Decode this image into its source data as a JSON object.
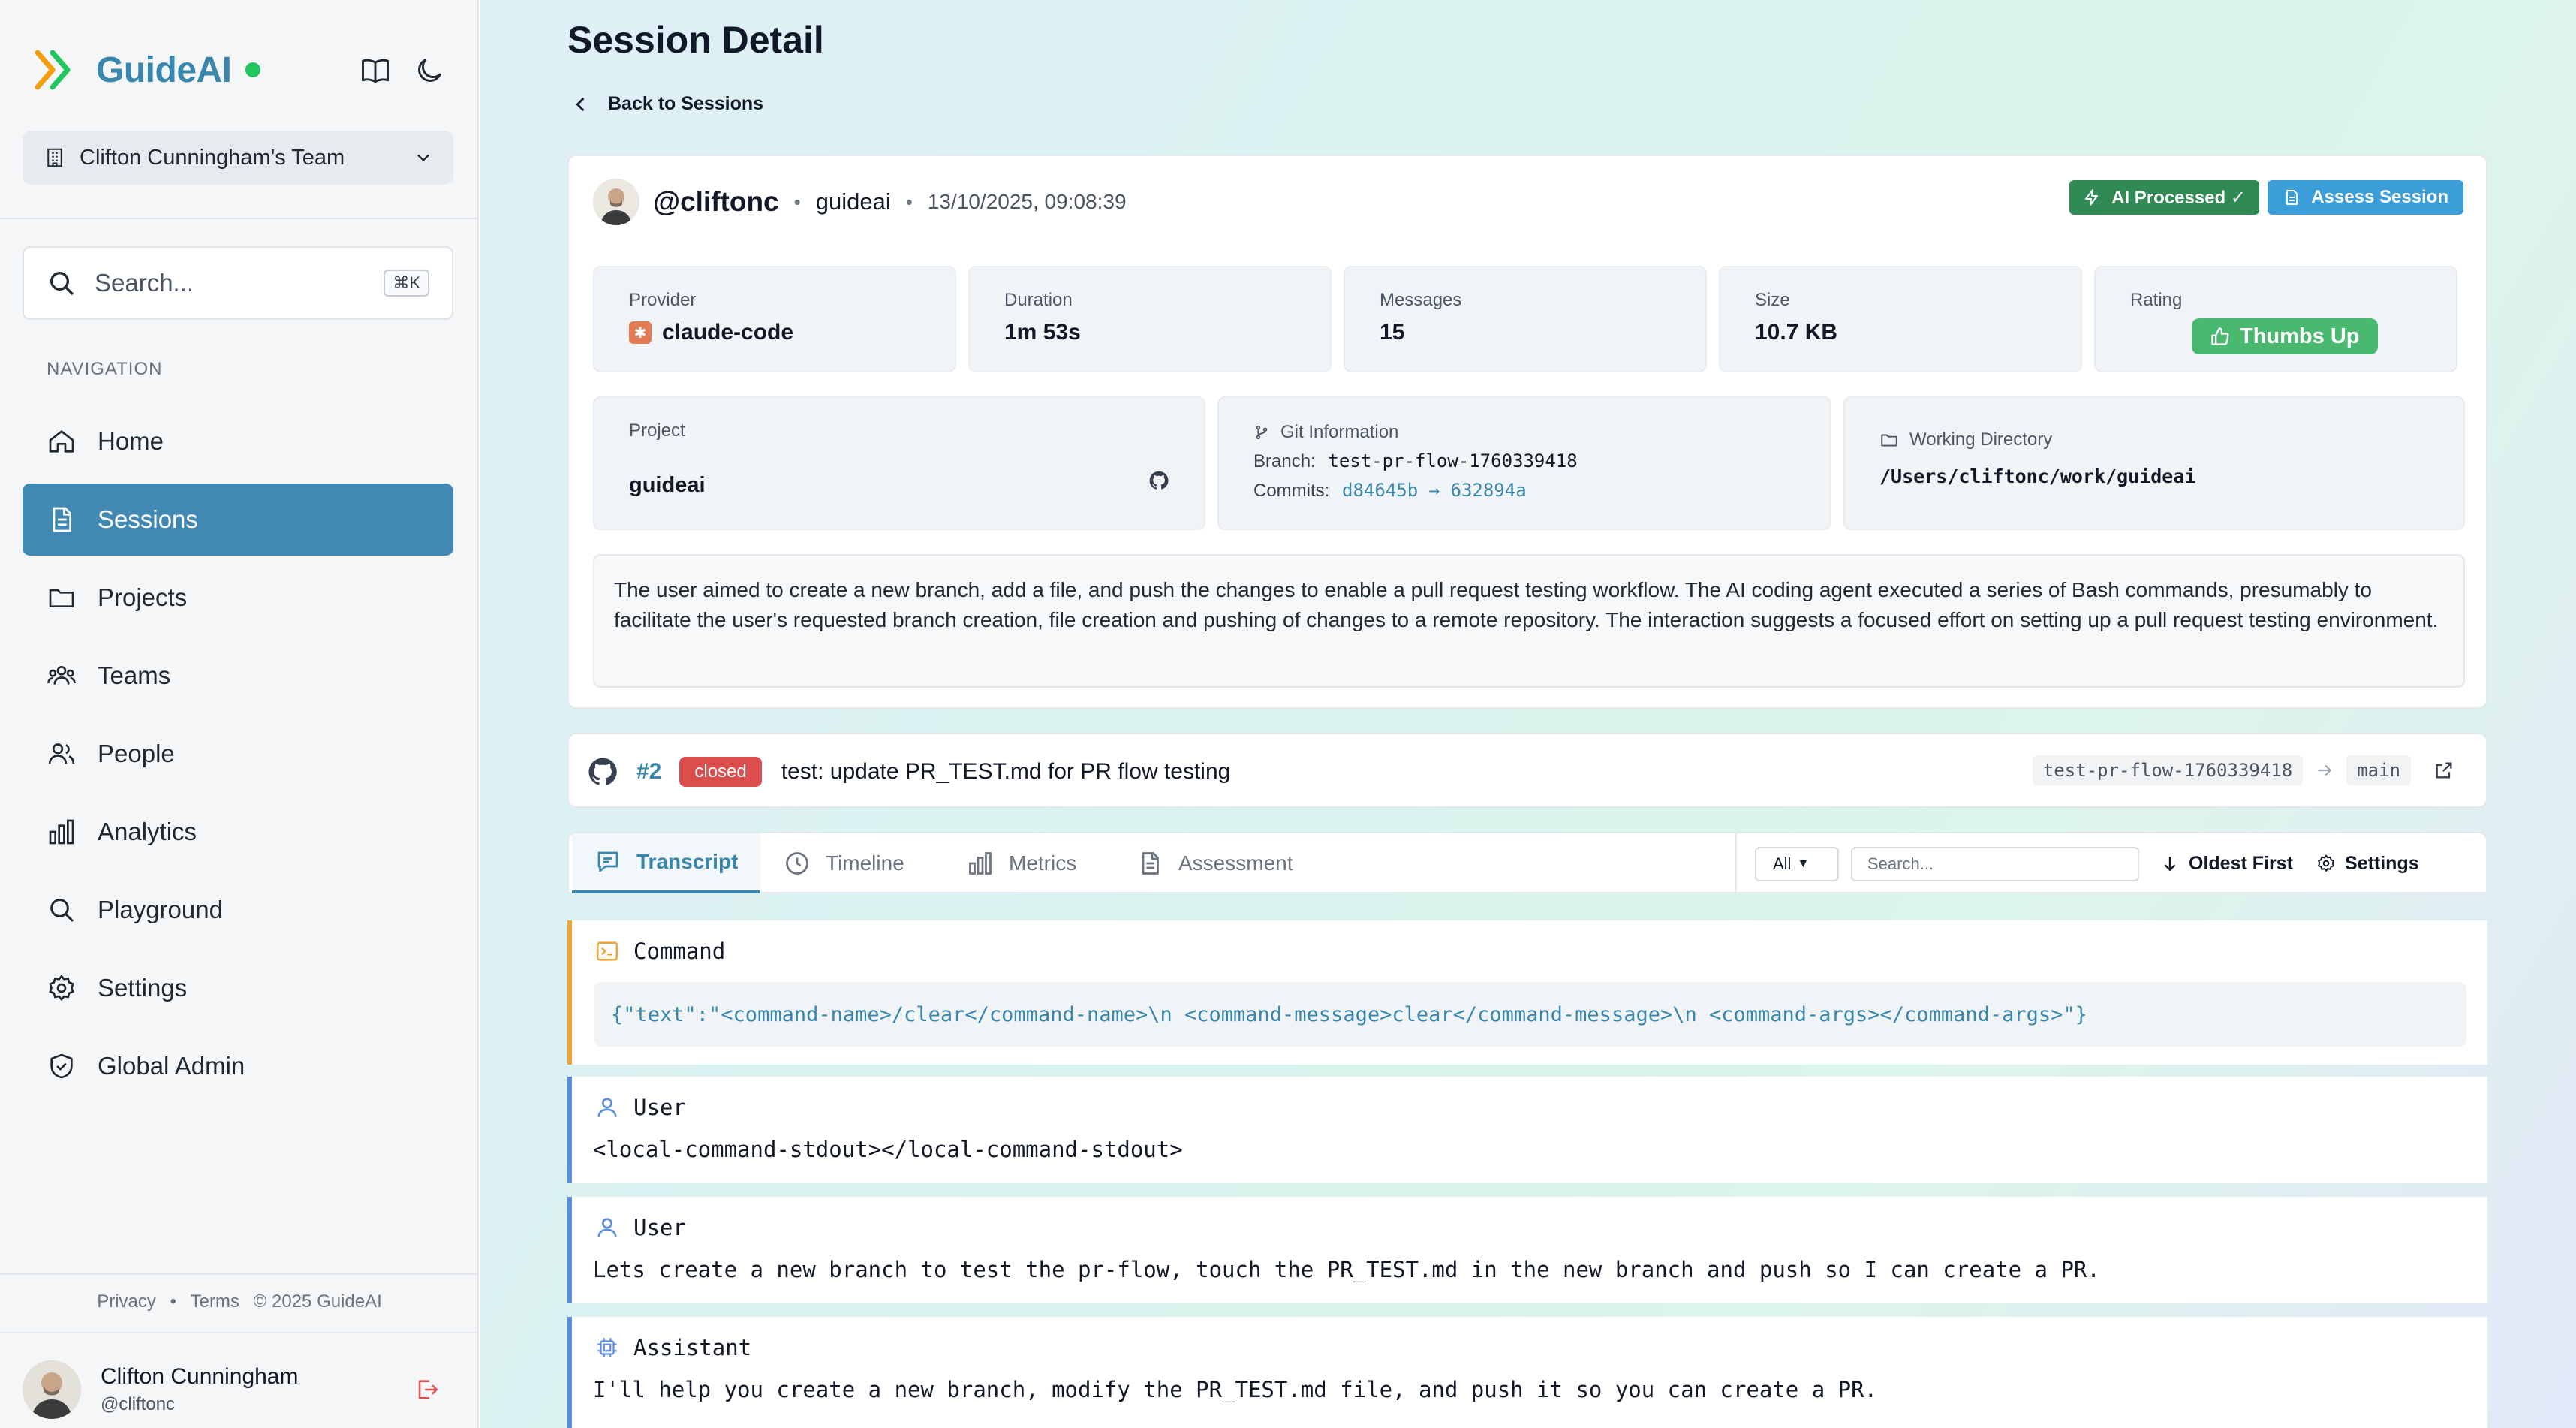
{
  "app": {
    "name": "GuideAI",
    "team": "Clifton Cunningham's Team",
    "search_placeholder": "Search...",
    "search_shortcut": "⌘K",
    "nav_heading": "NAVIGATION",
    "nav": [
      {
        "label": "Home",
        "icon": "home-icon"
      },
      {
        "label": "Sessions",
        "icon": "document-icon",
        "active": true
      },
      {
        "label": "Projects",
        "icon": "folder-icon"
      },
      {
        "label": "Teams",
        "icon": "team-icon"
      },
      {
        "label": "People",
        "icon": "people-icon"
      },
      {
        "label": "Analytics",
        "icon": "bar-chart-icon"
      },
      {
        "label": "Playground",
        "icon": "search-icon"
      },
      {
        "label": "Settings",
        "icon": "gear-icon"
      },
      {
        "label": "Global Admin",
        "icon": "shield-icon"
      }
    ],
    "footer": {
      "privacy": "Privacy",
      "sep": "•",
      "terms": "Terms",
      "copyright": "© 2025 GuideAI"
    },
    "user": {
      "name": "Clifton Cunningham",
      "handle": "@cliftonc"
    }
  },
  "page": {
    "title": "Session Detail",
    "back_label": "Back to Sessions"
  },
  "session": {
    "handle": "@cliftonc",
    "sep": "•",
    "project": "guideai",
    "datetime": "13/10/2025, 09:08:39",
    "ai_processed_label": "AI Processed ✓",
    "assess_label": "Assess Session",
    "stats": {
      "provider_label": "Provider",
      "provider_value": "claude-code",
      "duration_label": "Duration",
      "duration_value": "1m 53s",
      "messages_label": "Messages",
      "messages_value": "15",
      "size_label": "Size",
      "size_value": "10.7 KB",
      "rating_label": "Rating",
      "rating_value": "Thumbs Up"
    },
    "project_box": {
      "label": "Project",
      "name": "guideai"
    },
    "git": {
      "label": "Git Information",
      "branch_label": "Branch:",
      "branch": "test-pr-flow-1760339418",
      "commits_label": "Commits:",
      "commits": "d84645b → 632894a"
    },
    "working_dir": {
      "label": "Working Directory",
      "path": "/Users/cliftonc/work/guideai"
    },
    "summary": "The user aimed to create a new branch, add a file, and push the changes to enable a pull request testing workflow. The AI coding agent executed a series of Bash commands, presumably to facilitate the user's requested branch creation, file creation and pushing of changes to a remote repository. The interaction suggests a focused effort on setting up a pull request testing environment."
  },
  "pr": {
    "number": "#2",
    "state": "closed",
    "title": "test: update PR_TEST.md for PR flow testing",
    "head": "test-pr-flow-1760339418",
    "base": "main"
  },
  "tabs": [
    {
      "label": "Transcript",
      "icon": "chat-icon",
      "active": true
    },
    {
      "label": "Timeline",
      "icon": "clock-icon"
    },
    {
      "label": "Metrics",
      "icon": "bar-chart-icon"
    },
    {
      "label": "Assessment",
      "icon": "document-icon"
    }
  ],
  "toolbar": {
    "filter_value": "All",
    "search_placeholder": "Search...",
    "sort_label": "Oldest First",
    "settings_label": "Settings"
  },
  "messages": [
    {
      "role": "Command",
      "content": "{\"text\":\"<command-name>/clear</command-name>\\n <command-message>clear</command-message>\\n <command-args></command-args>\"}"
    },
    {
      "role": "User",
      "content": "<local-command-stdout></local-command-stdout>"
    },
    {
      "role": "User",
      "content": "Lets create a new branch to test the pr-flow, touch the PR_TEST.md in the new branch and push so I can create a PR."
    },
    {
      "role": "Assistant",
      "content": "I'll help you create a new branch, modify the PR_TEST.md file, and push it so you can create a PR."
    }
  ],
  "colors": {
    "brand": "#3a87ad",
    "active_nav": "#4189b2",
    "ai_processed": "#2f8a54",
    "assess": "#3b9ed9",
    "thumbs_up": "#49b96f",
    "closed_badge": "#dc4e4e",
    "online_dot": "#22c55e"
  }
}
